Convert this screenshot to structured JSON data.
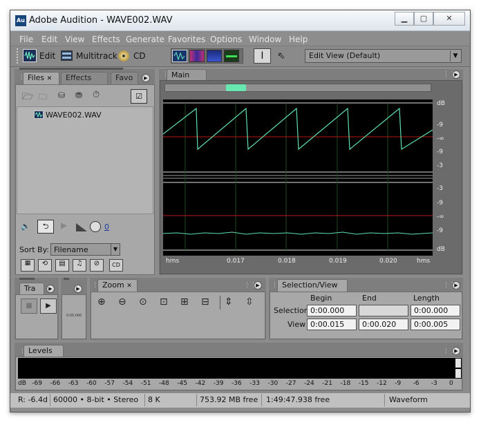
{
  "window": {
    "title": "Adobe Audition - WAVE002.WAV",
    "app_icon": "Au"
  },
  "menu": [
    "File",
    "Edit",
    "View",
    "Effects",
    "Generate",
    "Favorites",
    "Options",
    "Window",
    "Help"
  ],
  "toolbar": {
    "edit_label": "Edit",
    "multitrack_label": "Multitrack",
    "cd_label": "CD",
    "workspace": "Edit View (Default)"
  },
  "files_panel": {
    "tabs": [
      "Files",
      "Effects",
      "Favo"
    ],
    "file": "WAVE002.WAV",
    "sort_label": "Sort By:",
    "sort_value": "Filename",
    "volume_value": "0"
  },
  "main_panel": {
    "tab": "Main",
    "db_top": [
      "dB",
      "-9",
      "-∞",
      "-9",
      "-3"
    ],
    "db_bottom": [
      "-3",
      "-9",
      "-∞",
      "-9",
      "dB"
    ],
    "time_ticks": [
      "hms",
      "0.017",
      "0.018",
      "0.019",
      "0.020",
      "hms"
    ]
  },
  "transport": {
    "tab": "Tra",
    "time": "0:00.000"
  },
  "zoom": {
    "tab": "Zoom"
  },
  "selection": {
    "tab": "Selection/View",
    "col_begin": "Begin",
    "col_end": "End",
    "col_length": "Length",
    "row_selection": "Selection",
    "row_view": "View",
    "sel_begin": "0:00.000",
    "sel_end": "",
    "sel_length": "0:00.000",
    "view_begin": "0:00.015",
    "view_end": "0:00.020",
    "view_length": "0:00.005"
  },
  "levels": {
    "tab": "Levels",
    "ticks": [
      "dB",
      "-69",
      "-66",
      "-63",
      "-60",
      "-57",
      "-54",
      "-51",
      "-48",
      "-45",
      "-42",
      "-39",
      "-36",
      "-33",
      "-30",
      "-27",
      "-24",
      "-21",
      "-18",
      "-15",
      "-12",
      "-9",
      "-6",
      "-3",
      "0"
    ]
  },
  "status": {
    "peak": "R: -6.4d",
    "format": "60000 • 8-bit • Stereo",
    "size": "8 K",
    "free_mb": "753.92 MB free",
    "free_time": "1:49:47.938 free",
    "mode": "Waveform"
  },
  "colors": {
    "waveform": "#5fe0b0",
    "centerline": "#c01818",
    "scroll_thumb": "#66e8b0"
  }
}
